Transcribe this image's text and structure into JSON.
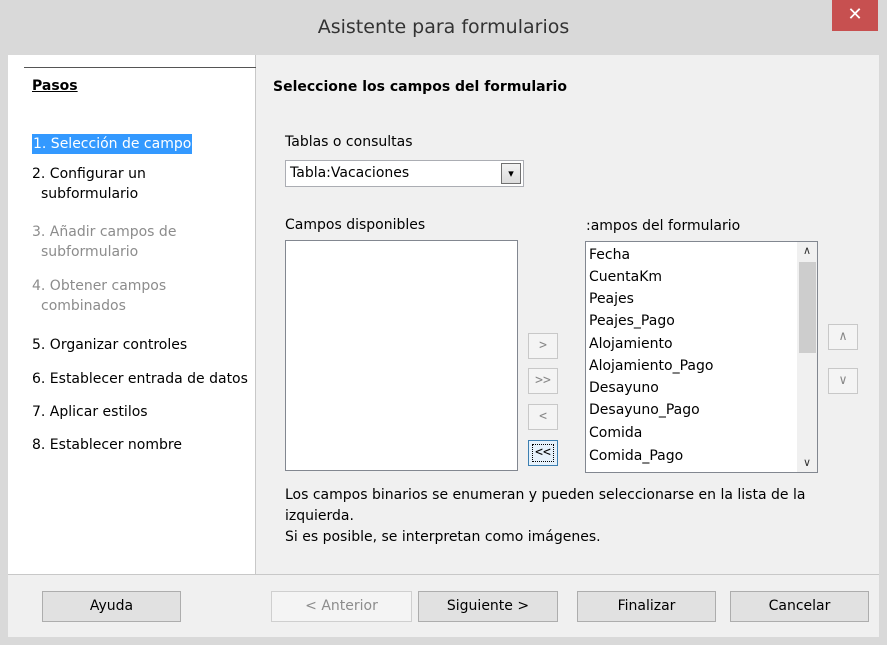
{
  "window": {
    "title": "Asistente para formularios",
    "close_glyph": "✕"
  },
  "steps": {
    "title": "Pasos",
    "items": [
      {
        "label": "1. Selección de campo",
        "state": "active"
      },
      {
        "label_line1": "2. Configurar un",
        "label_line2": "subformulario",
        "state": "enabled"
      },
      {
        "label_line1": "3. Añadir campos de",
        "label_line2": "subformulario",
        "state": "disabled"
      },
      {
        "label_line1": "4. Obtener campos",
        "label_line2": "combinados",
        "state": "disabled"
      },
      {
        "label": "5. Organizar controles",
        "state": "enabled"
      },
      {
        "label": "6. Establecer entrada de datos",
        "state": "enabled"
      },
      {
        "label": "7. Aplicar estilos",
        "state": "enabled"
      },
      {
        "label": "8. Establecer nombre",
        "state": "enabled"
      }
    ]
  },
  "main": {
    "heading": "Seleccione los campos del formulario",
    "tables_label": "Tablas o consultas",
    "tables_selected": "Tabla:Vacaciones",
    "available_label": "Campos disponibles",
    "form_fields_label": ":ampos del formulario",
    "form_fields": [
      "Fecha",
      "CuentaKm",
      "Peajes",
      "Peajes_Pago",
      "Alojamiento",
      "Alojamiento_Pago",
      "Desayuno",
      "Desayuno_Pago",
      "Comida",
      "Comida_Pago"
    ],
    "move_buttons": {
      "add": ">",
      "add_all": ">>",
      "remove": "<",
      "remove_all": "<<"
    },
    "order_buttons": {
      "up": "∧",
      "down": "∨"
    },
    "info_line1": "Los campos binarios se enumeran y pueden seleccionarse en la lista de la",
    "info_line2": "izquierda.",
    "info_line3": "Si es posible, se interpretan como imágenes."
  },
  "footer": {
    "help": "Ayuda",
    "back": "< Anterior",
    "next": "Siguiente >",
    "finish": "Finalizar",
    "cancel": "Cancelar"
  },
  "colors": {
    "accent": "#3399ff",
    "close": "#c75050"
  }
}
